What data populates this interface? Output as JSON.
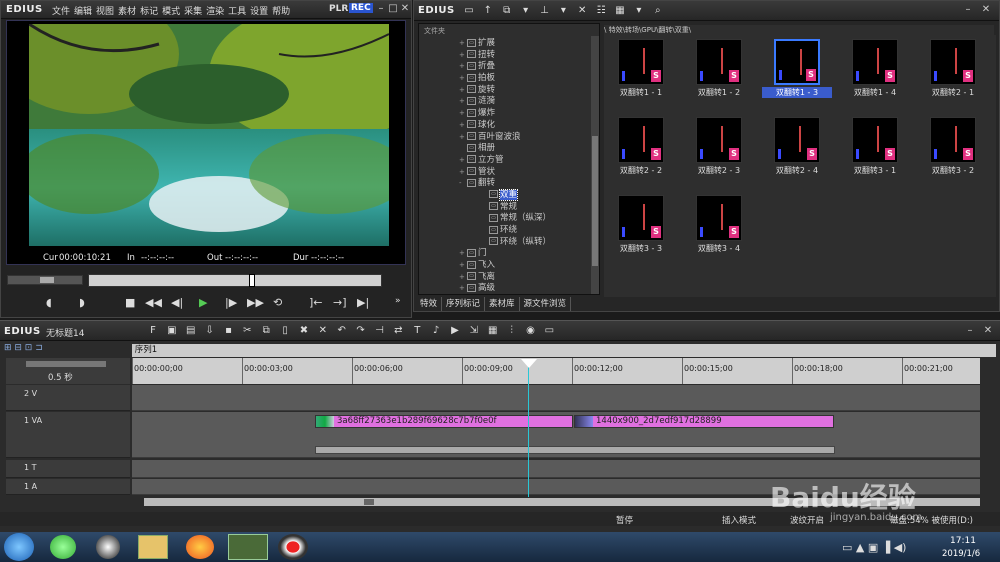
{
  "player": {
    "logo": "EDIUS",
    "menu": [
      "文件",
      "编辑",
      "视图",
      "素材",
      "标记",
      "模式",
      "采集",
      "渲染",
      "工具",
      "设置",
      "帮助"
    ],
    "plr": "PLR",
    "rec": "REC",
    "cur_label": "Cur",
    "cur_value": "00:00:10:21",
    "in_label": "In",
    "in_value": "--:--:--:--",
    "out_label": "Out",
    "out_value": "--:--:--:--",
    "dur_label": "Dur",
    "dur_value": "--:--:--:--"
  },
  "bin": {
    "logo": "EDIUS",
    "folder_header": "文件夹",
    "path": "\\ 特效\\转场\\GPU\\翻转\\双重\\",
    "tree": [
      {
        "label": "扩展",
        "exp": "+"
      },
      {
        "label": "扭转",
        "exp": "+"
      },
      {
        "label": "折叠",
        "exp": "+"
      },
      {
        "label": "拍板",
        "exp": "+"
      },
      {
        "label": "旋转",
        "exp": "+"
      },
      {
        "label": "涟漪",
        "exp": "+"
      },
      {
        "label": "爆炸",
        "exp": "+"
      },
      {
        "label": "球化",
        "exp": "+"
      },
      {
        "label": "百叶窗波浪",
        "exp": "+"
      },
      {
        "label": "相册",
        "exp": ""
      },
      {
        "label": "立方管",
        "exp": "+"
      },
      {
        "label": "管状",
        "exp": "+"
      },
      {
        "label": "翻转",
        "exp": "-"
      },
      {
        "label": "双重",
        "exp": "",
        "sub": true,
        "selected": true
      },
      {
        "label": "常规",
        "exp": "",
        "sub": true
      },
      {
        "label": "常规（纵深）",
        "exp": "",
        "sub": true
      },
      {
        "label": "环绕",
        "exp": "",
        "sub": true
      },
      {
        "label": "环绕（纵转）",
        "exp": "",
        "sub": true
      },
      {
        "label": "门",
        "exp": "+"
      },
      {
        "label": "飞入",
        "exp": "+"
      },
      {
        "label": "飞离",
        "exp": "+"
      },
      {
        "label": "高级",
        "exp": "+"
      }
    ],
    "items": [
      "双翻转1 - 1",
      "双翻转1 - 2",
      "双翻转1 - 3",
      "双翻转1 - 4",
      "双翻转2 - 1",
      "双翻转2 - 2",
      "双翻转2 - 3",
      "双翻转2 - 4",
      "双翻转3 - 1",
      "双翻转3 - 2",
      "双翻转3 - 3",
      "双翻转3 - 4"
    ],
    "tabs": [
      "特效",
      "序列标记",
      "素材库",
      "源文件浏览"
    ]
  },
  "timeline": {
    "logo": "EDIUS",
    "project": "无标题14",
    "sequence_tab": "序列1",
    "scale": "0.5 秒",
    "ruler": [
      "00:00:00;00",
      "00:00:03;00",
      "00:00:06;00",
      "00:00:09;00",
      "00:00:12;00",
      "00:00:15;00",
      "00:00:18;00",
      "00:00:21;00"
    ],
    "tracks": {
      "v2": "2 V",
      "va1": "1 VA",
      "t1": "1 T",
      "a1": "1 A"
    },
    "clips": [
      {
        "name": "3a68ff27363e1b289f69628c7b7f0e0f"
      },
      {
        "name": "1440x900_2d7edf917d28899"
      }
    ],
    "status": {
      "pause": "暂停",
      "insert": "插入模式",
      "ripple": "波纹开启",
      "disk": "磁盘:54% 被使用(D:)"
    }
  },
  "taskbar": {
    "time": "17:11",
    "date": "2019/1/6"
  },
  "watermark": {
    "text": "Baidu经验",
    "url": "jingyan.baidu.com"
  },
  "colors": {
    "accent": "#3a5ccc",
    "clip": "#e070e0",
    "pink": "#e03080"
  }
}
